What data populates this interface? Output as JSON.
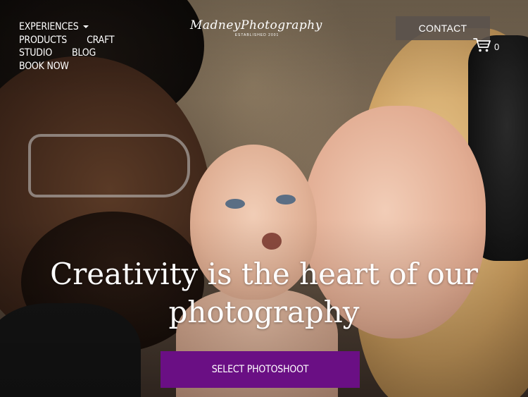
{
  "nav": {
    "experiences": "EXPERIENCES",
    "products": "PRODUCTS",
    "craft": "CRAFT",
    "studio": "STUDIO",
    "blog": "BLOG",
    "book_now": "BOOK NOW"
  },
  "logo": {
    "name": "MadneyPhotography",
    "tagline": "ESTABLISHED 2001"
  },
  "header": {
    "contact_label": "CONTACT",
    "cart_count": "0"
  },
  "hero": {
    "headline_line1": "Creativity is the heart of our",
    "headline_line2": "photography",
    "cta_label": "SELECT PHOTOSHOOT"
  },
  "colors": {
    "cta_background": "#6a0f84",
    "contact_background": "#5a524c",
    "text": "#ffffff"
  },
  "icons": {
    "cart": "shopping-cart-icon",
    "dropdown": "chevron-down-icon"
  }
}
